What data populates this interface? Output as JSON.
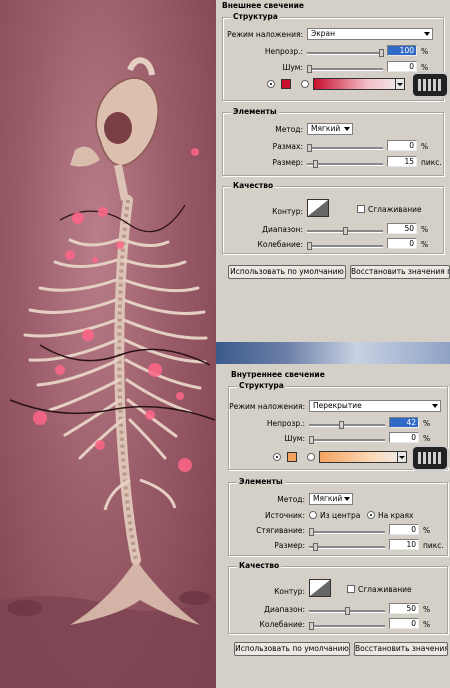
{
  "glow": {
    "title": "Внешнее свечение",
    "structure": {
      "title": "Структура",
      "blend_label": "Режим наложения:",
      "blend_value": "Экран",
      "opacity_label": "Непрозр.:",
      "opacity_value": "100",
      "noise_label": "Шум:",
      "noise_value": "0",
      "percent": "%",
      "swatch_color": "#c8102e"
    },
    "elements": {
      "title": "Элементы",
      "method_label": "Метод:",
      "method_value": "Мягкий",
      "spread_label": "Размах:",
      "spread_value": "0",
      "size_label": "Размер:",
      "size_value": "15",
      "percent": "%",
      "px": "пикс."
    },
    "quality": {
      "title": "Качество",
      "contour_label": "Контур:",
      "antialias_label": "Сглаживание",
      "range_label": "Диапазон:",
      "range_value": "50",
      "jitter_label": "Колебание:",
      "jitter_value": "0",
      "percent": "%"
    },
    "buttons": {
      "default": "Использовать по умолчанию",
      "reset": "Восстановить значения по"
    }
  },
  "inner": {
    "title": "Внутреннее свечение",
    "structure": {
      "title": "Структура",
      "blend_label": "Режим наложения:",
      "blend_value": "Перекрытие",
      "opacity_label": "Непрозр.:",
      "opacity_value": "42",
      "noise_label": "Шум:",
      "noise_value": "0",
      "percent": "%",
      "swatch_color": "#f4a460"
    },
    "elements": {
      "title": "Элементы",
      "method_label": "Метод:",
      "method_value": "Мягкий",
      "source_label": "Источник:",
      "source_center": "Из центра",
      "source_edge": "На краях",
      "choke_label": "Стягивание:",
      "choke_value": "0",
      "size_label": "Размер:",
      "size_value": "10",
      "percent": "%",
      "px": "пикс."
    },
    "quality": {
      "title": "Качество",
      "contour_label": "Контур:",
      "antialias_label": "Сглаживание",
      "range_label": "Диапазон:",
      "range_value": "50",
      "jitter_label": "Колебание:",
      "jitter_value": "0",
      "percent": "%"
    },
    "buttons": {
      "default": "Использовать по умолчанию",
      "reset": "Восстановить значения по"
    }
  },
  "colors": {
    "art_bg": "#9b5c69",
    "bone": "#e9d3c6",
    "lights": "#ff5577"
  }
}
